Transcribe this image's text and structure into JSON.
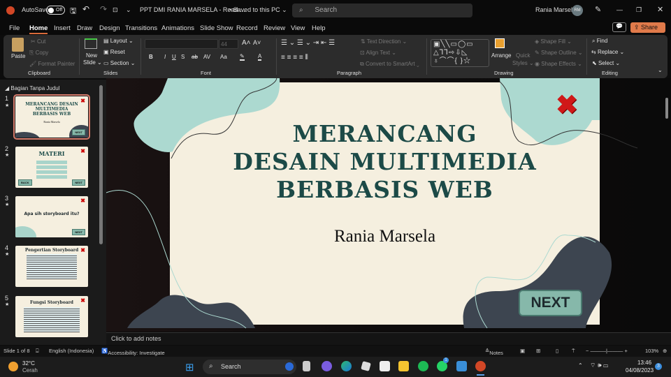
{
  "titlebar": {
    "autosave": "AutoSave",
    "autosave_state": "Off",
    "doc_title": "PPT DMI RANIA MARSELA  -  Read-...",
    "save_state": "• Saved to this PC ⌄",
    "search_placeholder": "Search",
    "user": "Rania Marsela",
    "initials": "RM"
  },
  "menu": {
    "tabs": [
      "File",
      "Home",
      "Insert",
      "Draw",
      "Design",
      "Transitions",
      "Animations",
      "Slide Show",
      "Record",
      "Review",
      "View",
      "Help"
    ],
    "share": "Share"
  },
  "ribbon": {
    "clipboard": {
      "paste": "Paste",
      "cut": "Cut",
      "copy": "Copy",
      "format_painter": "Format Painter",
      "label": "Clipboard"
    },
    "slides": {
      "new_slide": "New",
      "new_slide2": "Slide ⌄",
      "layout": "Layout ⌄",
      "reset": "Reset",
      "section": "Section ⌄",
      "label": "Slides"
    },
    "font": {
      "size": "44",
      "label": "Font",
      "buttons": [
        "B",
        "I",
        "U",
        "S",
        "ab",
        "AV",
        "Aa",
        "A"
      ]
    },
    "paragraph": {
      "text_direction": "Text Direction ⌄",
      "align_text": "Align Text ⌄",
      "convert": "Convert to SmartArt ⌄",
      "label": "Paragraph"
    },
    "drawing": {
      "arrange": "Arrange",
      "quick_styles": "Quick",
      "quick_styles2": "Styles ⌄",
      "shape_fill": "Shape Fill ⌄",
      "shape_outline": "Shape Outline ⌄",
      "shape_effects": "Shape Effects ⌄",
      "label": "Drawing"
    },
    "editing": {
      "find": "Find",
      "replace": "Replace",
      "select": "Select ⌄",
      "label": "Editing"
    }
  },
  "panel": {
    "section": "Bagian Tanpa Judul",
    "thumbs": [
      {
        "num": "1",
        "title": "MERANCANG DESAIN MULTIMEDIA BERBASIS WEB",
        "sub": "Rania Marsela",
        "btn": "NEXT"
      },
      {
        "num": "2",
        "title": "MATERI",
        "btn": "NEXT",
        "back": "BACK"
      },
      {
        "num": "3",
        "title": "Apa sih storyboard itu?",
        "btn": "NEXT"
      },
      {
        "num": "4",
        "title": "Pengertian Storyboard"
      },
      {
        "num": "5",
        "title": "Fungsi Storyboard"
      }
    ]
  },
  "slide": {
    "title_lines": [
      "MERANCANG",
      "DESAIN MULTIMEDIA",
      "BERBASIS WEB"
    ],
    "subtitle": "Rania Marsela",
    "next": "NEXT"
  },
  "notes": "Click to add notes",
  "status": {
    "slide": "Slide 1 of 8",
    "language": "English (Indonesia)",
    "accessibility": "Accessibility: Investigate",
    "notes": "Notes",
    "zoom": "103%"
  },
  "taskbar": {
    "temp": "32°C",
    "weather": "Cerah",
    "search": "Search",
    "time": "13:46",
    "date": "04/08/2023",
    "badge": "3",
    "whatsapp_badge": "1"
  }
}
